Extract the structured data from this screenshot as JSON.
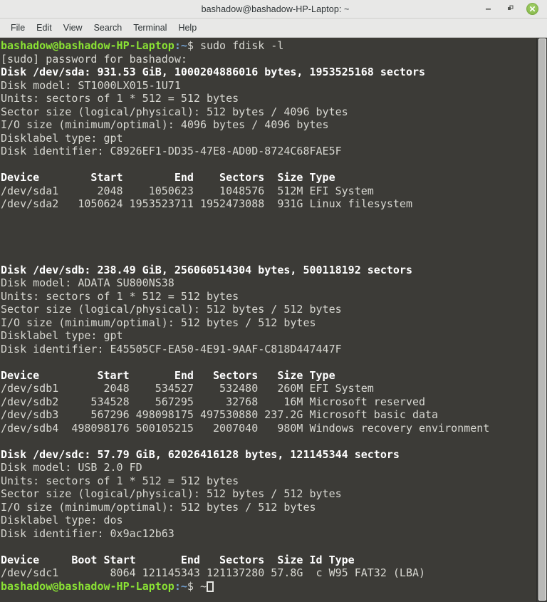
{
  "window": {
    "title": "bashadow@bashadow-HP-Laptop: ~",
    "controls": {
      "minimize_label": "–",
      "maximize_label": "❐",
      "close_label": "×"
    }
  },
  "menubar": {
    "items": [
      {
        "label": "File"
      },
      {
        "label": "Edit"
      },
      {
        "label": "View"
      },
      {
        "label": "Search"
      },
      {
        "label": "Terminal"
      },
      {
        "label": "Help"
      }
    ]
  },
  "colors": {
    "terminal_background": "#3c3b37",
    "terminal_foreground": "#d8d8d2",
    "prompt_user_host": "#8ae234",
    "prompt_path": "#729fcf",
    "bold_white": "#ffffff",
    "titlebar_background": "#e8e8e7",
    "close_button": "#8bc34a"
  },
  "terminal": {
    "prompt": {
      "user_host": "bashadow@bashadow-HP-Laptop",
      "colon": ":",
      "path": "~",
      "sigil": "$"
    },
    "command": " sudo fdisk -l",
    "password_line": "[sudo] password for bashadow:",
    "final_prompt_input": " ~",
    "disks": [
      {
        "header": "Disk /dev/sda: 931.53 GiB, 1000204886016 bytes, 1953525168 sectors",
        "info": [
          "Disk model: ST1000LX015-1U71",
          "Units: sectors of 1 * 512 = 512 bytes",
          "Sector size (logical/physical): 512 bytes / 4096 bytes",
          "I/O size (minimum/optimal): 4096 bytes / 4096 bytes",
          "Disklabel type: gpt",
          "Disk identifier: C8926EF1-DD35-47E8-AD0D-8724C68FAE5F"
        ],
        "table_header": "Device        Start        End    Sectors  Size Type",
        "rows": [
          "/dev/sda1      2048    1050623    1048576  512M EFI System",
          "/dev/sda2   1050624 1953523711 1952473088  931G Linux filesystem"
        ],
        "blank_lines_after": 4
      },
      {
        "header": "Disk /dev/sdb: 238.49 GiB, 256060514304 bytes, 500118192 sectors",
        "info": [
          "Disk model: ADATA SU800NS38",
          "Units: sectors of 1 * 512 = 512 bytes",
          "Sector size (logical/physical): 512 bytes / 512 bytes",
          "I/O size (minimum/optimal): 512 bytes / 512 bytes",
          "Disklabel type: gpt",
          "Disk identifier: E45505CF-EA50-4E91-9AAF-C818D447447F"
        ],
        "table_header": "Device         Start       End   Sectors   Size Type",
        "rows": [
          "/dev/sdb1       2048    534527    532480   260M EFI System",
          "/dev/sdb2     534528    567295     32768    16M Microsoft reserved",
          "/dev/sdb3     567296 498098175 497530880 237.2G Microsoft basic data",
          "/dev/sdb4  498098176 500105215   2007040   980M Windows recovery environment"
        ],
        "blank_lines_after": 1
      },
      {
        "header": "Disk /dev/sdc: 57.79 GiB, 62026416128 bytes, 121145344 sectors",
        "info": [
          "Disk model: USB 2.0 FD",
          "Units: sectors of 1 * 512 = 512 bytes",
          "Sector size (logical/physical): 512 bytes / 512 bytes",
          "I/O size (minimum/optimal): 512 bytes / 512 bytes",
          "Disklabel type: dos",
          "Disk identifier: 0x9ac12b63"
        ],
        "table_header": "Device     Boot Start       End   Sectors  Size Id Type",
        "rows": [
          "/dev/sdc1        8064 121145343 121137280 57.8G  c W95 FAT32 (LBA)"
        ],
        "blank_lines_after": 0
      }
    ]
  }
}
